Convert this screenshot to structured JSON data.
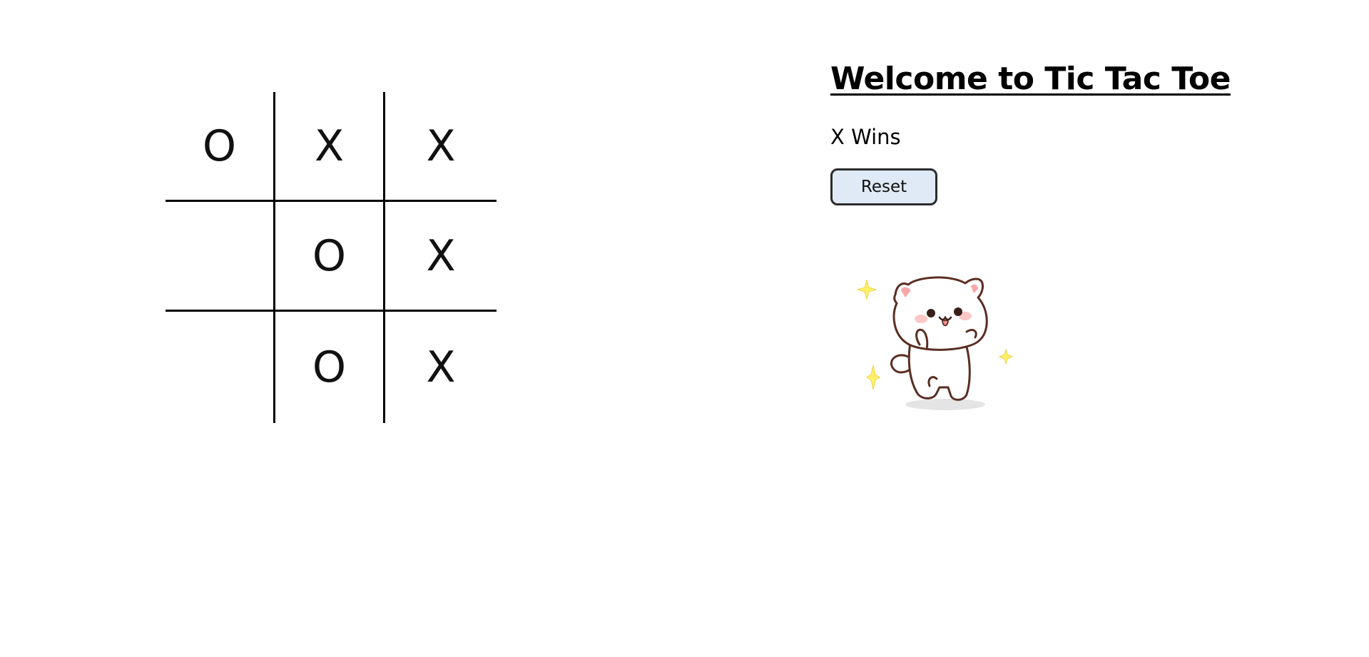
{
  "board": {
    "cells": [
      [
        "O",
        "X",
        "X"
      ],
      [
        "",
        "O",
        "X"
      ],
      [
        "",
        "O",
        "X"
      ]
    ]
  },
  "info": {
    "title": "Welcome to Tic Tac Toe",
    "status": "X Wins",
    "reset_label": "Reset"
  },
  "sticker": {
    "icon": "happy-cat-sticker",
    "sparkle_color": "#fff06a",
    "outline_color": "#5a2e22",
    "blush_color": "#ffc7c7"
  }
}
